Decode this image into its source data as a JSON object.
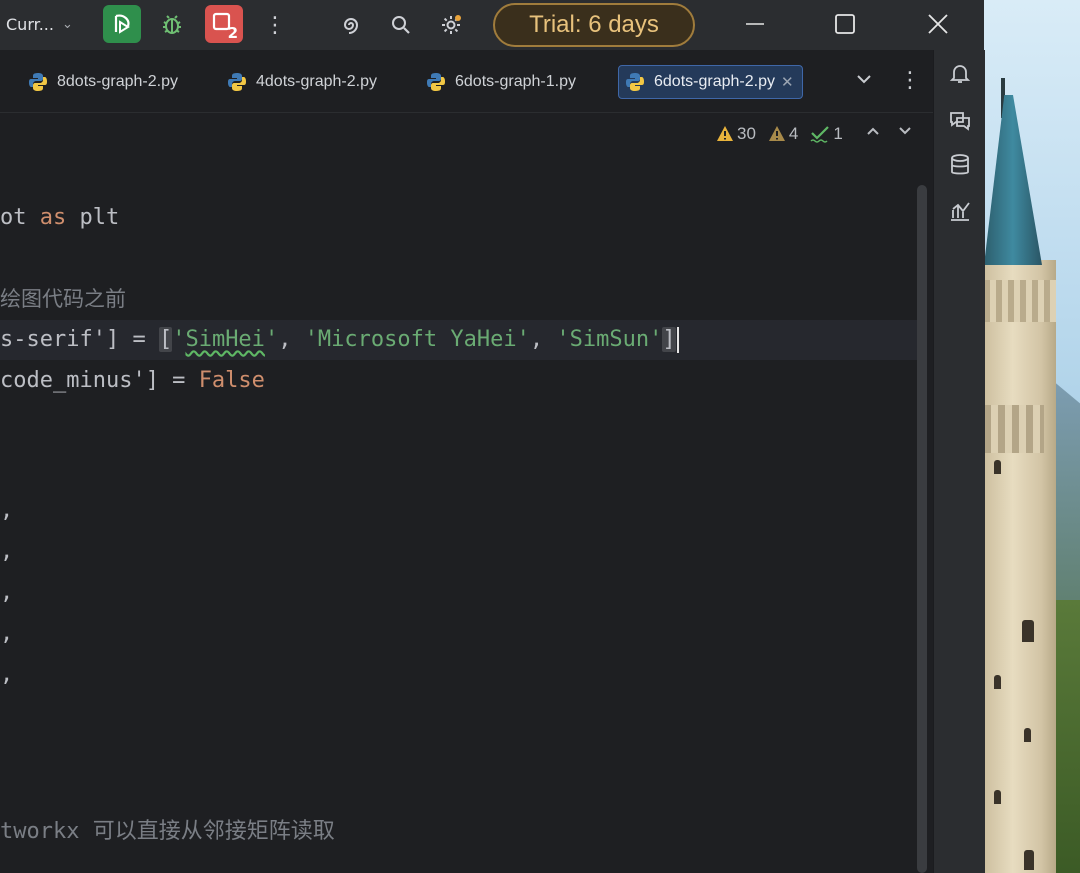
{
  "titlebar": {
    "project": "Curr...",
    "trial": "Trial: 6 days",
    "stop_badge": "2"
  },
  "tabs": [
    {
      "label": "8dots-graph-2.py"
    },
    {
      "label": "4dots-graph-2.py"
    },
    {
      "label": "6dots-graph-1.py"
    },
    {
      "label": "6dots-graph-2.py",
      "active": true
    }
  ],
  "inspections": {
    "warnings": "30",
    "weak_warnings": "4",
    "ok": "1"
  },
  "code": {
    "l1_a": "ot ",
    "l1_kw": "as",
    "l1_b": " plt",
    "l2_comment": "绘图代码之前",
    "l3_a": "s-serif'] = ",
    "l3_br": "[",
    "l3_s1": "'SimHei'",
    "l3_c1": ", ",
    "l3_s2": "'Microsoft YaHei'",
    "l3_c2": ", ",
    "l3_s3": "'SimSun'",
    "l3_br2": "]",
    "l4_a": "code_minus'] = ",
    "l4_kw": "False",
    "comma": ",",
    "l10_comment": "tworkx 可以直接从邻接矩阵读取"
  },
  "colors": {
    "run_button": "#2f8f4c",
    "stop_button": "#d9534f",
    "trial_text": "#e8c27c",
    "keyword": "#cf8e6d",
    "string": "#6aab73",
    "comment": "#7a7e85"
  }
}
